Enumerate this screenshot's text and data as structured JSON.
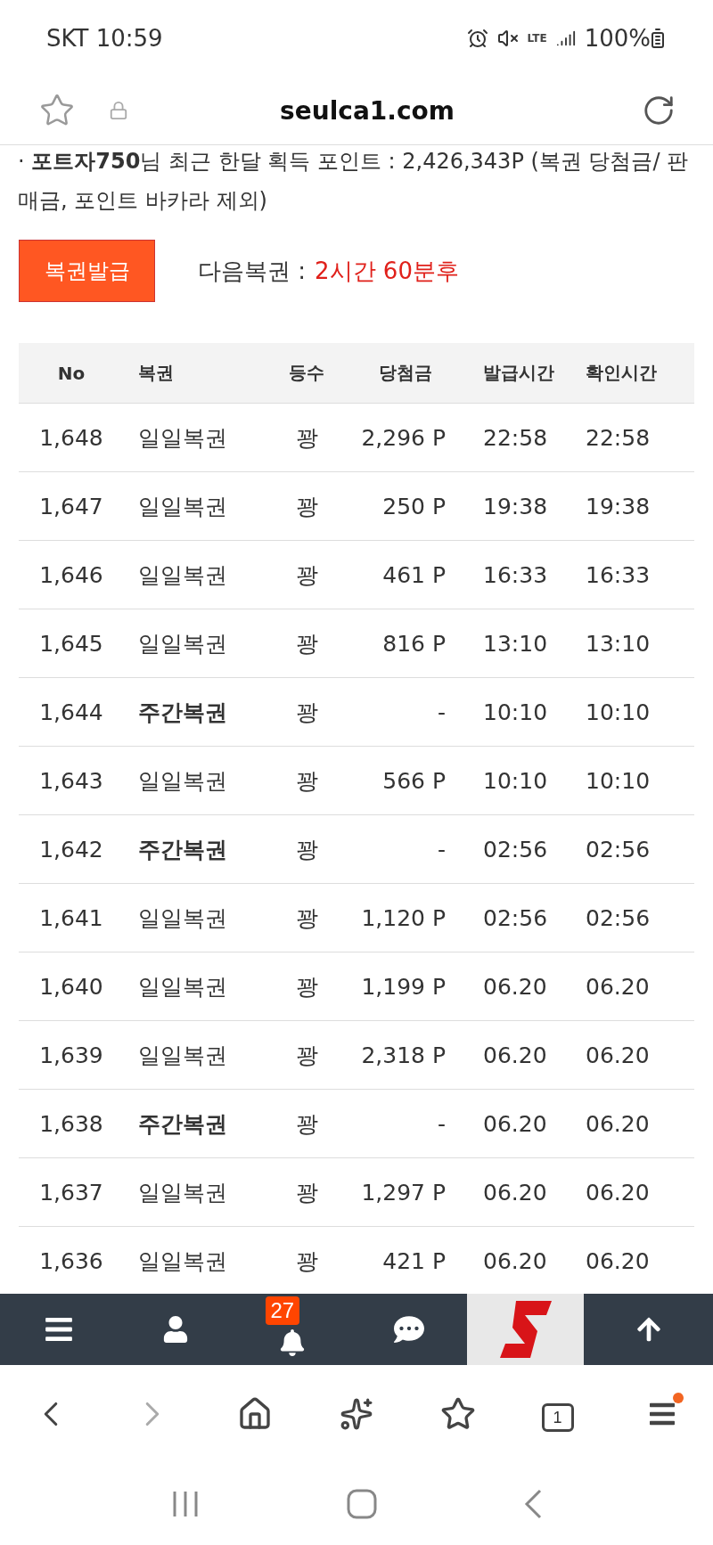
{
  "status_bar": {
    "carrier_time": "SKT 10:59",
    "network": "LTE",
    "battery": "100%"
  },
  "address_bar": {
    "url": "seulca1.com"
  },
  "info": {
    "line": "· **포트자750**님 최근 한달 획득 포인트 : 2,426,343P (복권 당첨금/ 판매금, 포인트 바카라 제외)"
  },
  "issue_button": "복권발급",
  "next_lottery": {
    "label": "다음복권 :",
    "value": "2시간 60분후"
  },
  "table": {
    "columns": [
      "No",
      "복권",
      "등수",
      "당첨금",
      "발급시간",
      "확인시간"
    ],
    "rows": [
      {
        "no": "1,648",
        "ticket": "일일복권",
        "kind": "daily",
        "rank": "꽝",
        "prize": "2,296 P",
        "issued": "22:58",
        "checked": "22:58"
      },
      {
        "no": "1,647",
        "ticket": "일일복권",
        "kind": "daily",
        "rank": "꽝",
        "prize": "250 P",
        "issued": "19:38",
        "checked": "19:38"
      },
      {
        "no": "1,646",
        "ticket": "일일복권",
        "kind": "daily",
        "rank": "꽝",
        "prize": "461 P",
        "issued": "16:33",
        "checked": "16:33"
      },
      {
        "no": "1,645",
        "ticket": "일일복권",
        "kind": "daily",
        "rank": "꽝",
        "prize": "816 P",
        "issued": "13:10",
        "checked": "13:10"
      },
      {
        "no": "1,644",
        "ticket": "주간복권",
        "kind": "weekly",
        "rank": "꽝",
        "prize": "-",
        "issued": "10:10",
        "checked": "10:10"
      },
      {
        "no": "1,643",
        "ticket": "일일복권",
        "kind": "daily",
        "rank": "꽝",
        "prize": "566 P",
        "issued": "10:10",
        "checked": "10:10"
      },
      {
        "no": "1,642",
        "ticket": "주간복권",
        "kind": "weekly",
        "rank": "꽝",
        "prize": "-",
        "issued": "02:56",
        "checked": "02:56"
      },
      {
        "no": "1,641",
        "ticket": "일일복권",
        "kind": "daily",
        "rank": "꽝",
        "prize": "1,120 P",
        "issued": "02:56",
        "checked": "02:56"
      },
      {
        "no": "1,640",
        "ticket": "일일복권",
        "kind": "daily",
        "rank": "꽝",
        "prize": "1,199 P",
        "issued": "06.20",
        "checked": "06.20"
      },
      {
        "no": "1,639",
        "ticket": "일일복권",
        "kind": "daily",
        "rank": "꽝",
        "prize": "2,318 P",
        "issued": "06.20",
        "checked": "06.20"
      },
      {
        "no": "1,638",
        "ticket": "주간복권",
        "kind": "weekly",
        "rank": "꽝",
        "prize": "-",
        "issued": "06.20",
        "checked": "06.20"
      },
      {
        "no": "1,637",
        "ticket": "일일복권",
        "kind": "daily",
        "rank": "꽝",
        "prize": "1,297 P",
        "issued": "06.20",
        "checked": "06.20"
      },
      {
        "no": "1,636",
        "ticket": "일일복권",
        "kind": "daily",
        "rank": "꽝",
        "prize": "421 P",
        "issued": "06.20",
        "checked": "06.20"
      }
    ]
  },
  "site_nav": {
    "notification_count": "27"
  },
  "browser_toolbar": {
    "forward_disabled": true,
    "tab_count": "1",
    "menu_notification": true
  }
}
